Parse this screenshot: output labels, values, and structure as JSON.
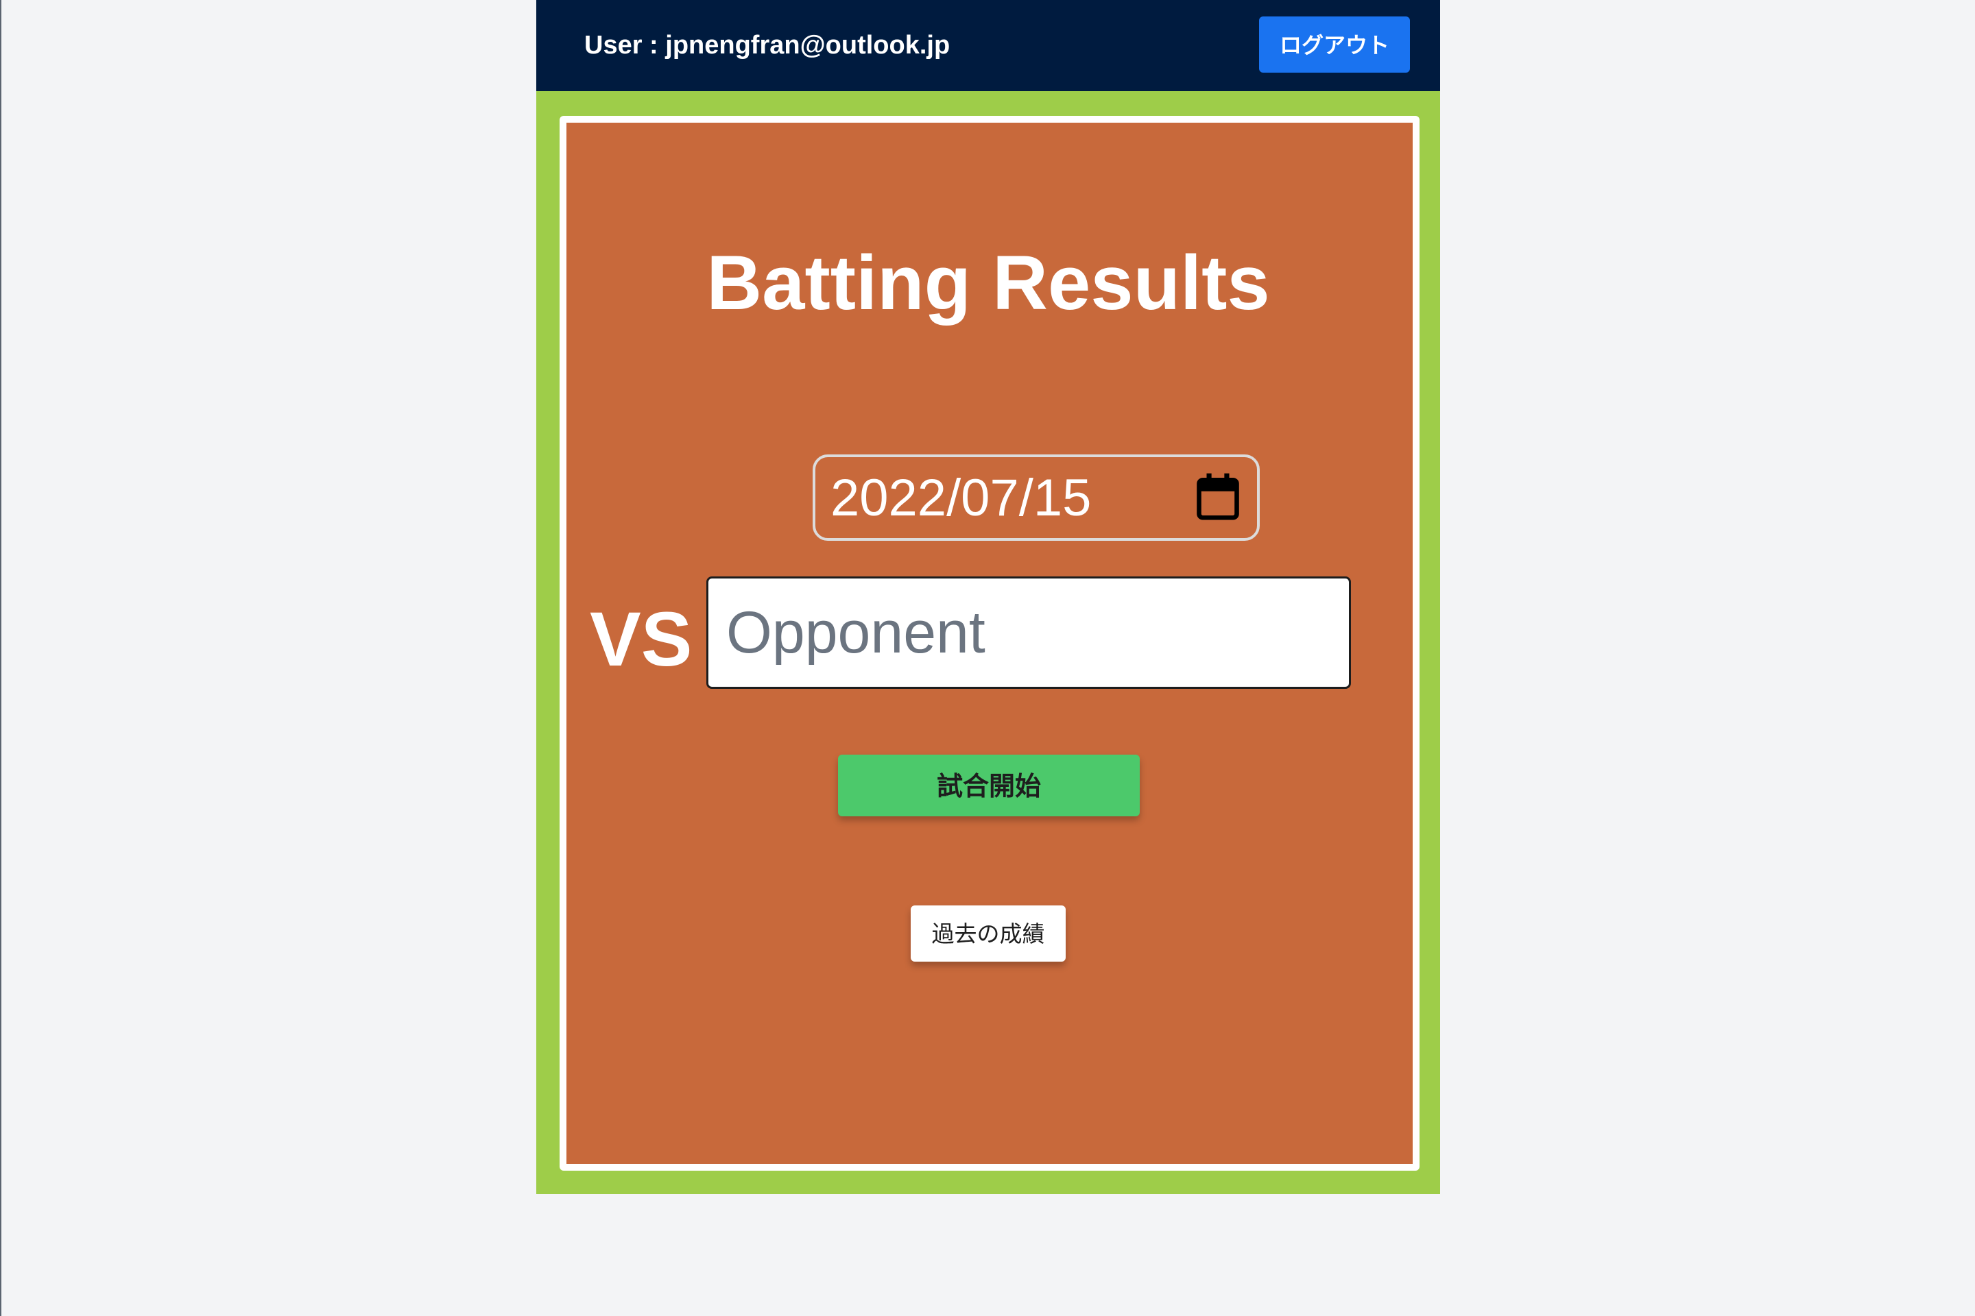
{
  "header": {
    "user_label": "User : jpnengfran@outlook.jp",
    "logout_label": "ログアウト"
  },
  "main": {
    "title": "Batting Results",
    "date_value": "2022/07/15",
    "vs_label": "VS",
    "opponent_placeholder": "Opponent",
    "opponent_value": "",
    "start_button_label": "試合開始",
    "history_button_label": "過去の成績"
  },
  "icons": {
    "date_picker": "calendar-icon"
  },
  "colors": {
    "header_bg": "#001b3f",
    "logout_button": "#1a73f0",
    "outfield_green": "#9ecd49",
    "infield_clay": "#c8693b",
    "start_button": "#4cc96b",
    "page_bg": "#f3f4f6"
  }
}
